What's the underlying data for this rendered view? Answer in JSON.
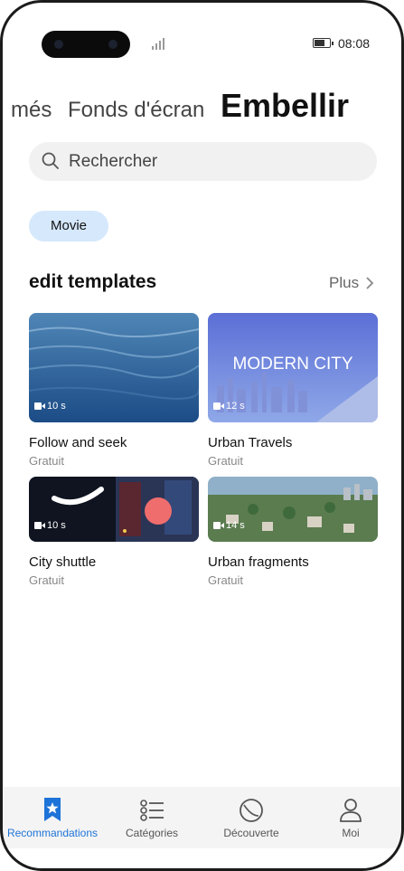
{
  "status": {
    "time": "08:08",
    "battery_level": 0.7
  },
  "tabs": [
    {
      "label": "més"
    },
    {
      "label": "Fonds d'écran"
    },
    {
      "label": "Embellir"
    }
  ],
  "search": {
    "placeholder": "Rechercher"
  },
  "chips": [
    {
      "label": "Movie"
    }
  ],
  "section": {
    "title": "edit templates",
    "more_label": "Plus"
  },
  "templates": [
    {
      "title": "Follow and seek",
      "price": "Gratuit",
      "duration": "10 s"
    },
    {
      "title": "Urban Travels",
      "price": "Gratuit",
      "duration": "12 s",
      "overlay_text": "MODERN CITY"
    },
    {
      "title": "City shuttle",
      "price": "Gratuit",
      "duration": "10 s"
    },
    {
      "title": "Urban fragments",
      "price": "Gratuit",
      "duration": "14 s"
    }
  ],
  "nav": [
    {
      "label": "Recommandations",
      "icon": "star-bookmark-icon",
      "active": true
    },
    {
      "label": "Catégories",
      "icon": "list-icon"
    },
    {
      "label": "Découverte",
      "icon": "compass-icon"
    },
    {
      "label": "Moi",
      "icon": "person-icon"
    }
  ],
  "colors": {
    "accent": "#1e73d8",
    "chip_bg": "#d5e8fc"
  }
}
